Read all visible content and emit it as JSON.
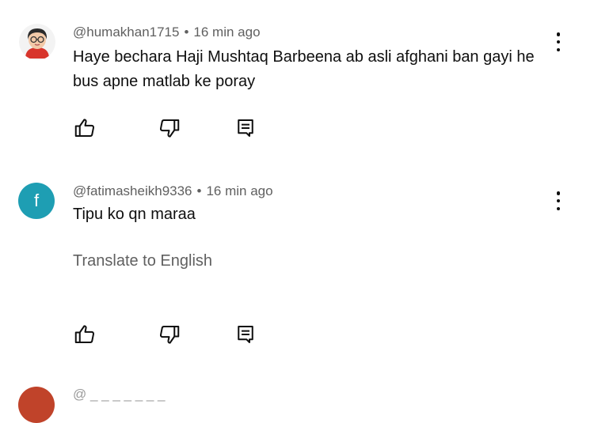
{
  "comments": [
    {
      "handle": "@humakhan1715",
      "separator": "•",
      "time": "16 min ago",
      "text": "Haye bechara Haji Mushtaq Barbeena ab asli afghani ban gayi he bus apne matlab ke poray",
      "avatar": {
        "type": "memoji",
        "bg": "#ffffff"
      }
    },
    {
      "handle": "@fatimasheikh9336",
      "separator": "•",
      "time": "16 min ago",
      "text": "Tipu ko qn maraa",
      "translate_label": "Translate to English",
      "avatar": {
        "type": "letter",
        "letter": "f",
        "bg": "#1e9eb3"
      }
    },
    {
      "handle": "@ &nbsp;",
      "avatar": {
        "type": "letter",
        "letter": "",
        "bg": "#c0432a"
      }
    }
  ],
  "icons": {
    "like": "thumbs-up-icon",
    "dislike": "thumbs-down-icon",
    "reply": "reply-icon",
    "more": "more-vert-icon"
  }
}
